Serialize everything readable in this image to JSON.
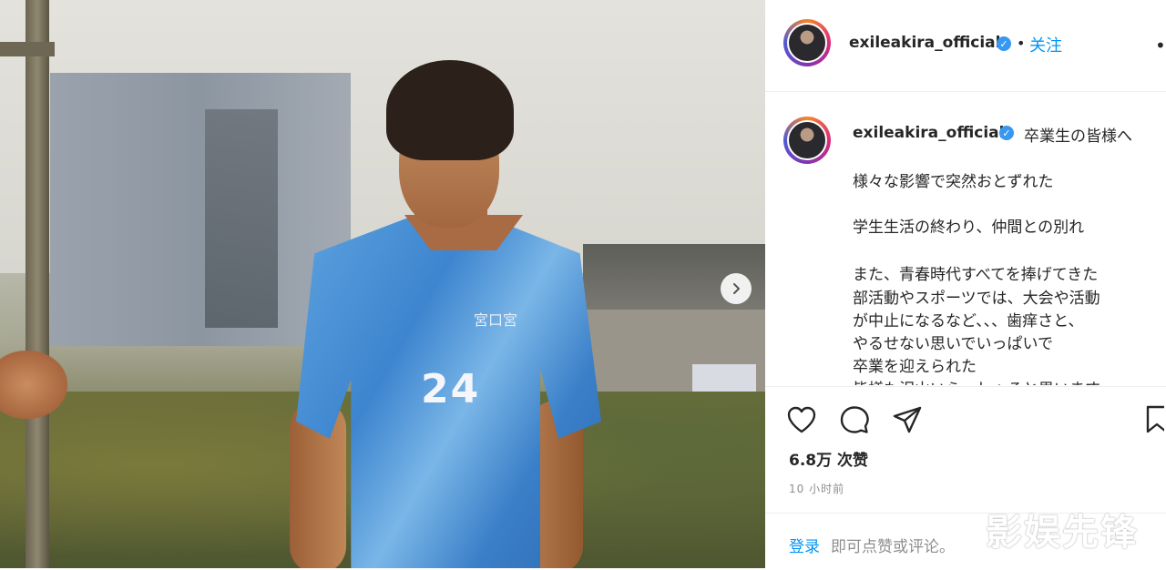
{
  "post": {
    "shirt_text": "宮口宮",
    "shirt_number": "24"
  },
  "header": {
    "username": "exileakira_official",
    "separator": "•",
    "follow_label": "关注",
    "more_label": "•••"
  },
  "caption": {
    "username": "exileakira_official",
    "first_line": "卒業生の皆様へ",
    "lines": [
      "様々な影響で突然おとずれた",
      "",
      "学生生活の終わり、仲間との別れ",
      "",
      "また、青春時代すべてを捧げてきた",
      "部活動やスポーツでは、大会や活動",
      "が中止になるなど、、、歯痒さと、",
      "やるせない思いでいっぱいで",
      "卒業を迎えられた",
      "皆様も沢山いらっしゃると思います"
    ]
  },
  "engagement": {
    "likes": "6.8万 次赞",
    "time_ago": "10 小时前"
  },
  "comment": {
    "login_label": "登录",
    "prompt": "即可点赞或评论。"
  },
  "icons": {
    "verified": "verified-badge-icon",
    "like": "heart-icon",
    "comment": "comment-bubble-icon",
    "share": "paper-plane-icon",
    "save": "bookmark-icon",
    "next": "chevron-right-icon"
  },
  "watermark": "影娱先锋",
  "colors": {
    "link": "#0095f6",
    "verified": "#3897f0",
    "text": "#262626",
    "muted": "#8e8e8e"
  }
}
